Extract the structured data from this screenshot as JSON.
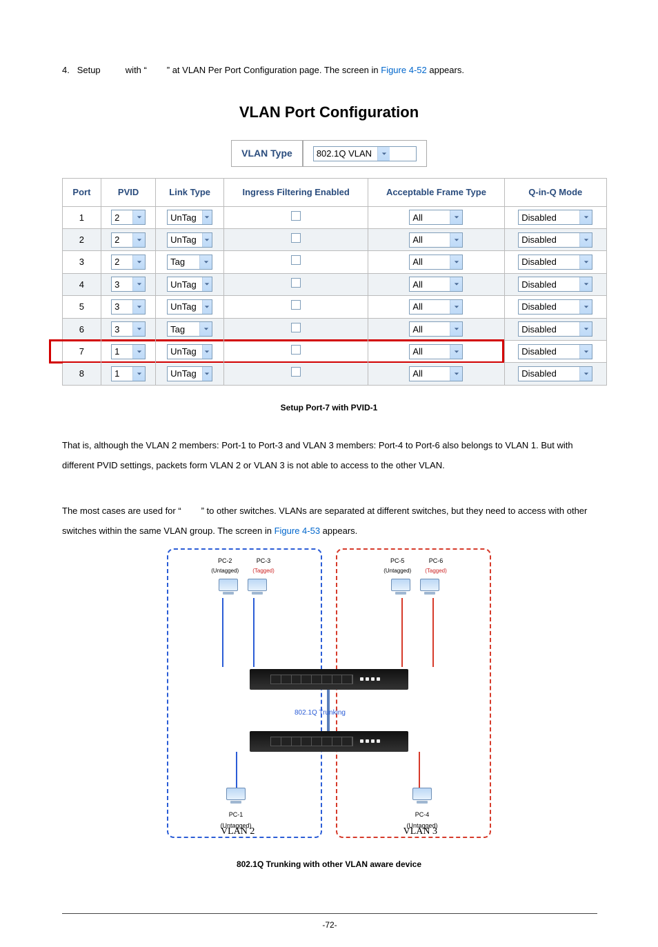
{
  "step": {
    "num": "4.",
    "label_a": "Setup",
    "label_b": "with “",
    "label_c": "” at VLAN Per Port Configuration page. The screen in ",
    "figref": "Figure 4-52",
    "label_d": " appears."
  },
  "page_title": "VLAN Port Configuration",
  "vlan_type": {
    "label": "VLAN Type",
    "value": "802.1Q VLAN"
  },
  "headers": {
    "port": "Port",
    "pvid": "PVID",
    "linktype": "Link Type",
    "ingress": "Ingress Filtering Enabled",
    "accept": "Acceptable Frame Type",
    "qinq": "Q-in-Q Mode"
  },
  "rows": [
    {
      "port": "1",
      "pvid": "2",
      "linktype": "UnTag",
      "accept": "All",
      "qinq": "Disabled",
      "highlight": false
    },
    {
      "port": "2",
      "pvid": "2",
      "linktype": "UnTag",
      "accept": "All",
      "qinq": "Disabled",
      "highlight": false
    },
    {
      "port": "3",
      "pvid": "2",
      "linktype": "Tag",
      "accept": "All",
      "qinq": "Disabled",
      "highlight": false
    },
    {
      "port": "4",
      "pvid": "3",
      "linktype": "UnTag",
      "accept": "All",
      "qinq": "Disabled",
      "highlight": false
    },
    {
      "port": "5",
      "pvid": "3",
      "linktype": "UnTag",
      "accept": "All",
      "qinq": "Disabled",
      "highlight": false
    },
    {
      "port": "6",
      "pvid": "3",
      "linktype": "Tag",
      "accept": "All",
      "qinq": "Disabled",
      "highlight": false
    },
    {
      "port": "7",
      "pvid": "1",
      "linktype": "UnTag",
      "accept": "All",
      "qinq": "Disabled",
      "highlight": true
    },
    {
      "port": "8",
      "pvid": "1",
      "linktype": "UnTag",
      "accept": "All",
      "qinq": "Disabled",
      "highlight": false
    }
  ],
  "caption1": "Setup Port-7 with PVID-1",
  "para1": "That is, although the VLAN 2 members: Port-1 to Port-3 and VLAN 3 members: Port-4 to Port-6 also belongs to VLAN 1. But with different PVID settings, packets form VLAN 2 or VLAN 3 is not able to access to the other VLAN.",
  "para2a": "The most cases are used for “",
  "para2b": "” to other switches. VLANs are separated at different switches, but they need to access with other switches within the same VLAN group. The screen in ",
  "figref2": "Figure 4-53",
  "para2c": " appears.",
  "diagram": {
    "pc2": "PC-2",
    "pc2_sub": "(Untagged)",
    "pc3": "PC-3",
    "pc3_sub": "(Tagged)",
    "pc5": "PC-5",
    "pc5_sub": "(Untagged)",
    "pc6": "PC-6",
    "pc6_sub": "(Tagged)",
    "pc1": "PC-1",
    "pc1_sub": "(Untagged)",
    "pc4": "PC-4",
    "pc4_sub": "(Untagged)",
    "trunk": "802.1Q Trunking",
    "vlan2": "VLAN 2",
    "vlan3": "VLAN 3"
  },
  "caption2": "802.1Q Trunking with other VLAN aware device",
  "page_num": "-72-"
}
